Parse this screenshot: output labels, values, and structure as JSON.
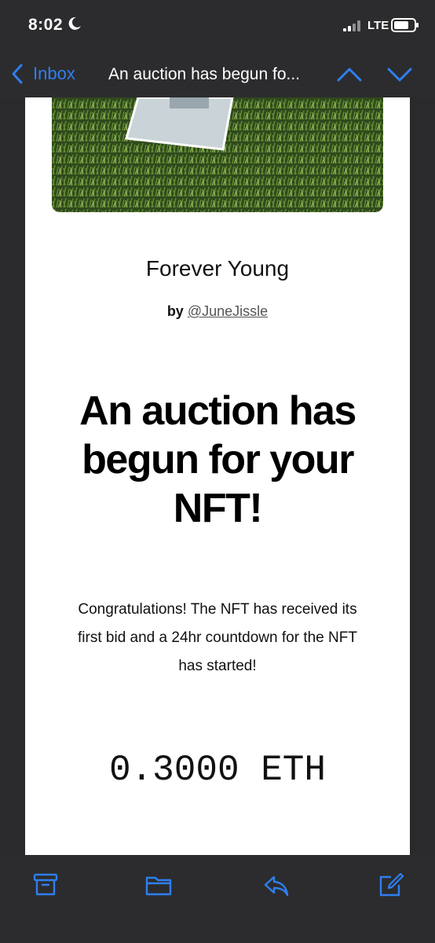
{
  "status_bar": {
    "time": "8:02",
    "network": "LTE",
    "icons": [
      "moon-icon",
      "signal-bars-icon",
      "battery-icon"
    ]
  },
  "nav": {
    "back_label": "Inbox",
    "title": "An auction has begun fo...",
    "icons": [
      "chevron-left-icon",
      "chevron-up-icon",
      "chevron-down-icon"
    ]
  },
  "email": {
    "nft_title": "Forever Young",
    "by_prefix": "by",
    "by_handle": "@JuneJissle",
    "headline_line1": "An auction has",
    "headline_line2": "begun for your",
    "headline_line3": "NFT!",
    "body_line1": "Congratulations! The NFT has received its",
    "body_line2": "first bid and a 24hr countdown for the NFT",
    "body_line3": "has started!",
    "bid_amount": "0.3000 ETH"
  },
  "toolbar": {
    "icons": [
      "archive-icon",
      "folder-icon",
      "reply-icon",
      "compose-icon"
    ]
  },
  "colors": {
    "accent": "#2f7ff0",
    "bar_background": "#2c2c2e",
    "card_background": "#ffffff"
  }
}
